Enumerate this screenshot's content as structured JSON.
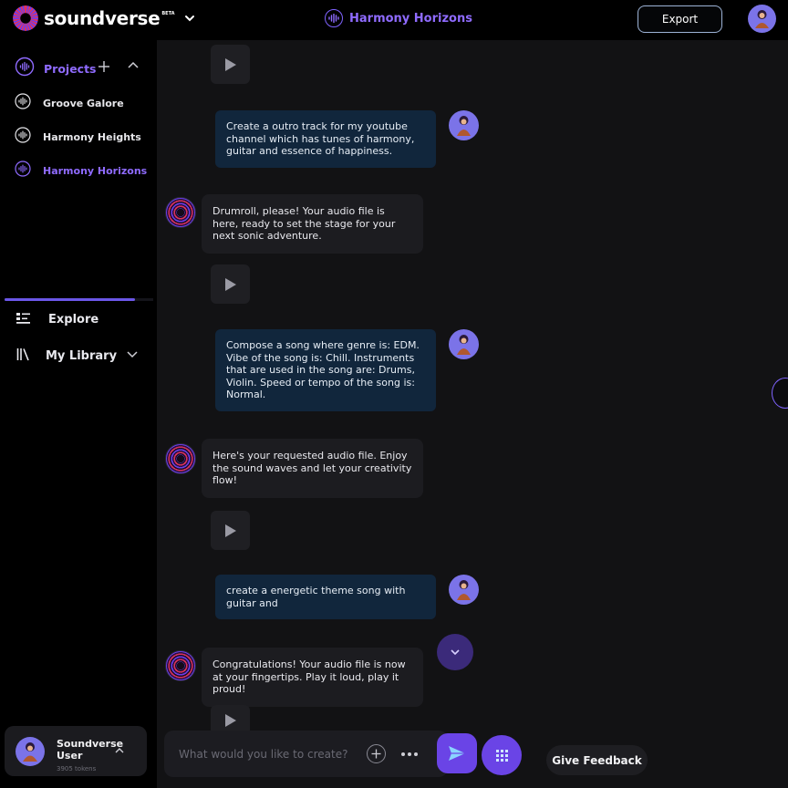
{
  "brand": {
    "name": "soundverse",
    "badge": "BETA"
  },
  "header": {
    "project_title": "Harmony Horizons",
    "export_label": "Export"
  },
  "sidebar": {
    "projects_label": "Projects",
    "projects": [
      {
        "label": "Groove Galore",
        "active": false
      },
      {
        "label": "Harmony Heights",
        "active": false
      },
      {
        "label": "Harmony Horizons",
        "active": true
      }
    ],
    "nav": [
      {
        "label": "Explore",
        "icon": "explore-icon"
      },
      {
        "label": "My Library",
        "icon": "library-icon"
      }
    ],
    "user": {
      "name": "Soundverse User",
      "tokens": "3905 tokens"
    }
  },
  "chat": {
    "messages": [
      {
        "role": "user",
        "text": "Create a outro track for my youtube channel which has tunes of harmony, guitar and essence of happiness."
      },
      {
        "role": "bot",
        "text": "Drumroll, please! Your audio file is here, ready to set the stage for your next sonic adventure."
      },
      {
        "role": "user",
        "text": "Compose a song where genre is: EDM. Vibe of the song is: Chill. Instruments that are used in the song are: Drums, Violin. Speed or tempo of the song is: Normal."
      },
      {
        "role": "bot",
        "text": "Here's your requested audio file. Enjoy the sound waves and let your creativity flow!"
      },
      {
        "role": "user",
        "text": "create a energetic theme song with guitar and"
      },
      {
        "role": "bot",
        "text": "Congratulations! Your audio file is now at your fingertips. Play it loud, play it proud!"
      }
    ]
  },
  "composer": {
    "placeholder": "What would you like to create?"
  },
  "feedback_label": "Give Feedback",
  "colors": {
    "accent": "#8f6bff",
    "user_bubble": "#11263c",
    "bot_bubble": "#1c1c20",
    "button": "#6a44e6"
  }
}
